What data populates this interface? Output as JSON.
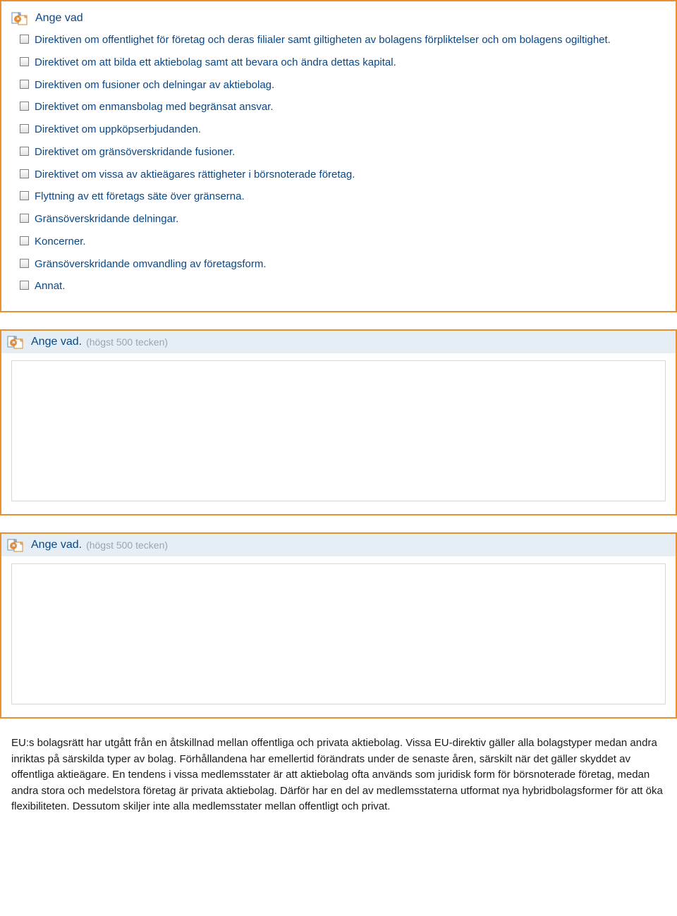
{
  "box1": {
    "title": "Ange vad",
    "items": [
      "Direktiven om offentlighet för företag och deras filialer samt giltigheten av bolagens förpliktelser och om bolagens ogiltighet.",
      "Direktivet om att bilda ett aktiebolag samt att bevara och ändra dettas kapital.",
      "Direktiven om fusioner och delningar av aktiebolag.",
      "Direktivet om enmansbolag med begränsat ansvar.",
      "Direktivet om uppköpserbjudanden.",
      "Direktivet om gränsöverskridande fusioner.",
      "Direktivet om vissa av aktieägares rättigheter i börsnoterade företag.",
      "Flyttning av ett företags säte över gränserna.",
      "Gränsöverskridande delningar.",
      "Koncerner.",
      "Gränsöverskridande omvandling av företagsform.",
      "Annat."
    ]
  },
  "box2": {
    "title": "Ange vad.",
    "hint": "(högst 500 tecken)"
  },
  "box3": {
    "title": "Ange vad.",
    "hint": "(högst 500 tecken)"
  },
  "paragraph": "EU:s bolagsrätt har utgått från en åtskillnad mellan offentliga och privata aktiebolag. Vissa EU-direktiv gäller alla bolagstyper medan andra inriktas på särskilda typer av bolag. Förhållandena har emellertid förändrats under de senaste åren, särskilt när det gäller skyddet av offentliga aktieägare. En tendens i vissa medlemsstater är att aktiebolag ofta används som juridisk form för börsnoterade företag, medan andra stora och medelstora företag är privata aktiebolag. Därför har en del av medlemsstaterna utformat nya hybridbolagsformer för att öka flexibiliteten. Dessutom skiljer inte alla medlemsstater mellan offentligt och privat."
}
